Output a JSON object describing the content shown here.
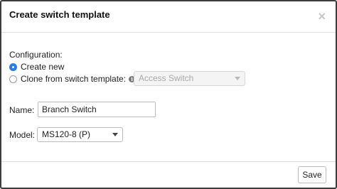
{
  "dialog": {
    "title": "Create switch template",
    "close_icon": "close-icon",
    "close_glyph": "×"
  },
  "configuration": {
    "label": "Configuration:",
    "options": [
      {
        "label": "Create new",
        "checked": true
      },
      {
        "label": "Clone from switch template:",
        "checked": false
      }
    ],
    "info_icon": "info-icon",
    "info_glyph": "i",
    "clone_select": {
      "value": "Access Switch",
      "disabled": true
    }
  },
  "name": {
    "label": "Name:",
    "value": "Branch Switch"
  },
  "model": {
    "label": "Model:",
    "value": "MS120-8 (P)"
  },
  "footer": {
    "save_label": "Save"
  },
  "colors": {
    "accent": "#2c7be5",
    "border": "#3c3c3c"
  }
}
